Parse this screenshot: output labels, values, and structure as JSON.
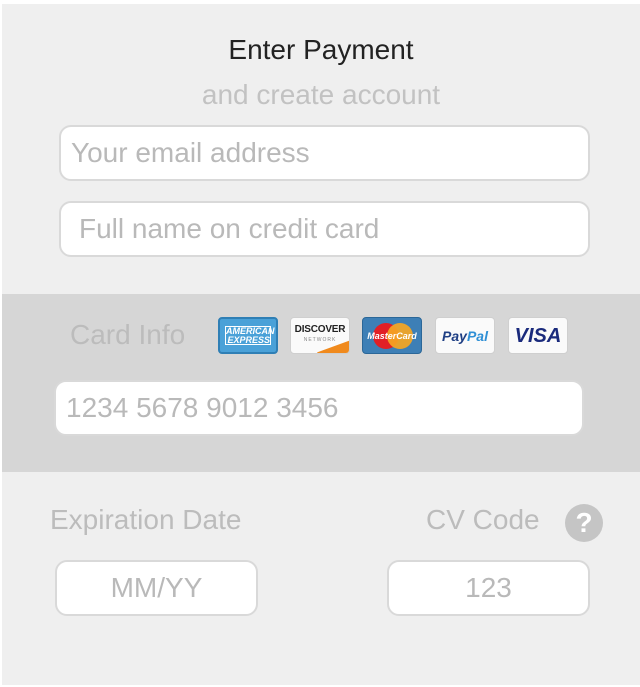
{
  "header": {
    "title": "Enter Payment",
    "subtitle": "and create account"
  },
  "account": {
    "email_placeholder": "Your email address",
    "name_placeholder": "Full name on credit card"
  },
  "card": {
    "label": "Card Info",
    "number_placeholder": "1234 5678 9012 3456",
    "logos": {
      "amex_line1": "AMERICAN",
      "amex_line2": "EXPRESS",
      "discover_name": "DISCOVER",
      "discover_sub": "NETWORK",
      "mastercard": "MasterCard",
      "paypal_pay": "Pay",
      "paypal_pal": "Pal",
      "visa": "VISA"
    }
  },
  "expiration": {
    "label": "Expiration Date",
    "placeholder": "MM/YY"
  },
  "cv": {
    "label": "CV Code",
    "placeholder": "123",
    "help_icon": "question-mark-icon",
    "help_glyph": "?"
  },
  "colors": {
    "panel_bg": "#efefef",
    "card_band_bg": "#d6d6d6",
    "placeholder_text": "#b9b9b9"
  }
}
